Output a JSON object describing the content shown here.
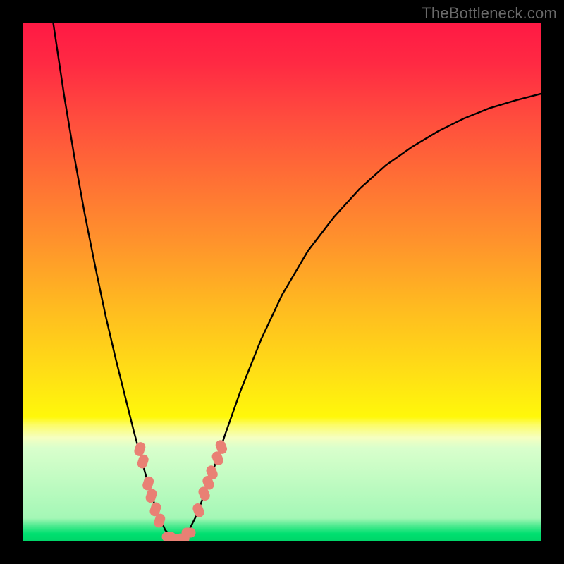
{
  "watermark": "TheBottleneck.com",
  "gradient_stops": [
    {
      "offset": 0.0,
      "color": "#ff1944"
    },
    {
      "offset": 0.08,
      "color": "#ff2a43"
    },
    {
      "offset": 0.18,
      "color": "#ff4b3e"
    },
    {
      "offset": 0.3,
      "color": "#ff6f35"
    },
    {
      "offset": 0.42,
      "color": "#ff922c"
    },
    {
      "offset": 0.55,
      "color": "#ffbb20"
    },
    {
      "offset": 0.68,
      "color": "#ffe015"
    },
    {
      "offset": 0.76,
      "color": "#fff80a"
    },
    {
      "offset": 0.775,
      "color": "#fcfc66"
    },
    {
      "offset": 0.8,
      "color": "#f5ffc0"
    },
    {
      "offset": 0.82,
      "color": "#d9ffcc"
    },
    {
      "offset": 0.955,
      "color": "#a4f7b6"
    },
    {
      "offset": 0.97,
      "color": "#4cea8f"
    },
    {
      "offset": 0.985,
      "color": "#00e070"
    },
    {
      "offset": 1.0,
      "color": "#00d468"
    }
  ],
  "chart_data": {
    "type": "line",
    "title": "",
    "xlabel": "",
    "ylabel": "",
    "xlim": [
      0,
      100
    ],
    "ylim": [
      0,
      100
    ],
    "curve": [
      {
        "x": 5.9,
        "y": 100.0
      },
      {
        "x": 6.5,
        "y": 96.0
      },
      {
        "x": 8.0,
        "y": 86.0
      },
      {
        "x": 10.0,
        "y": 74.0
      },
      {
        "x": 12.0,
        "y": 63.0
      },
      {
        "x": 14.0,
        "y": 53.0
      },
      {
        "x": 16.0,
        "y": 43.5
      },
      {
        "x": 18.0,
        "y": 35.0
      },
      {
        "x": 20.0,
        "y": 27.0
      },
      {
        "x": 21.5,
        "y": 21.0
      },
      {
        "x": 23.0,
        "y": 15.5
      },
      {
        "x": 24.5,
        "y": 10.0
      },
      {
        "x": 26.0,
        "y": 5.5
      },
      {
        "x": 27.5,
        "y": 2.2
      },
      {
        "x": 29.0,
        "y": 0.5
      },
      {
        "x": 30.5,
        "y": 0.5
      },
      {
        "x": 32.0,
        "y": 2.0
      },
      {
        "x": 33.5,
        "y": 5.0
      },
      {
        "x": 35.0,
        "y": 9.0
      },
      {
        "x": 37.0,
        "y": 14.5
      },
      {
        "x": 39.0,
        "y": 20.5
      },
      {
        "x": 42.0,
        "y": 29.0
      },
      {
        "x": 46.0,
        "y": 39.0
      },
      {
        "x": 50.0,
        "y": 47.5
      },
      {
        "x": 55.0,
        "y": 56.0
      },
      {
        "x": 60.0,
        "y": 62.5
      },
      {
        "x": 65.0,
        "y": 68.0
      },
      {
        "x": 70.0,
        "y": 72.5
      },
      {
        "x": 75.0,
        "y": 76.0
      },
      {
        "x": 80.0,
        "y": 79.0
      },
      {
        "x": 85.0,
        "y": 81.5
      },
      {
        "x": 90.0,
        "y": 83.5
      },
      {
        "x": 95.0,
        "y": 85.0
      },
      {
        "x": 100.0,
        "y": 86.3
      }
    ],
    "markers_left": [
      {
        "x": 22.6,
        "y": 17.8
      },
      {
        "x": 23.2,
        "y": 15.4
      },
      {
        "x": 24.2,
        "y": 11.2
      },
      {
        "x": 24.8,
        "y": 8.8
      },
      {
        "x": 25.6,
        "y": 6.2
      },
      {
        "x": 26.4,
        "y": 4.0
      }
    ],
    "markers_right": [
      {
        "x": 33.9,
        "y": 6.0
      },
      {
        "x": 35.0,
        "y": 9.2
      },
      {
        "x": 35.8,
        "y": 11.3
      },
      {
        "x": 36.5,
        "y": 13.3
      },
      {
        "x": 37.6,
        "y": 16.0
      },
      {
        "x": 38.3,
        "y": 18.2
      }
    ],
    "markers_bottom": [
      {
        "x": 28.2,
        "y": 0.9
      },
      {
        "x": 29.5,
        "y": 0.5
      },
      {
        "x": 30.8,
        "y": 0.6
      },
      {
        "x": 32.0,
        "y": 1.7
      }
    ],
    "marker_style": {
      "rx": 7,
      "ry": 10,
      "fill": "#e98074",
      "corner": 7
    }
  }
}
